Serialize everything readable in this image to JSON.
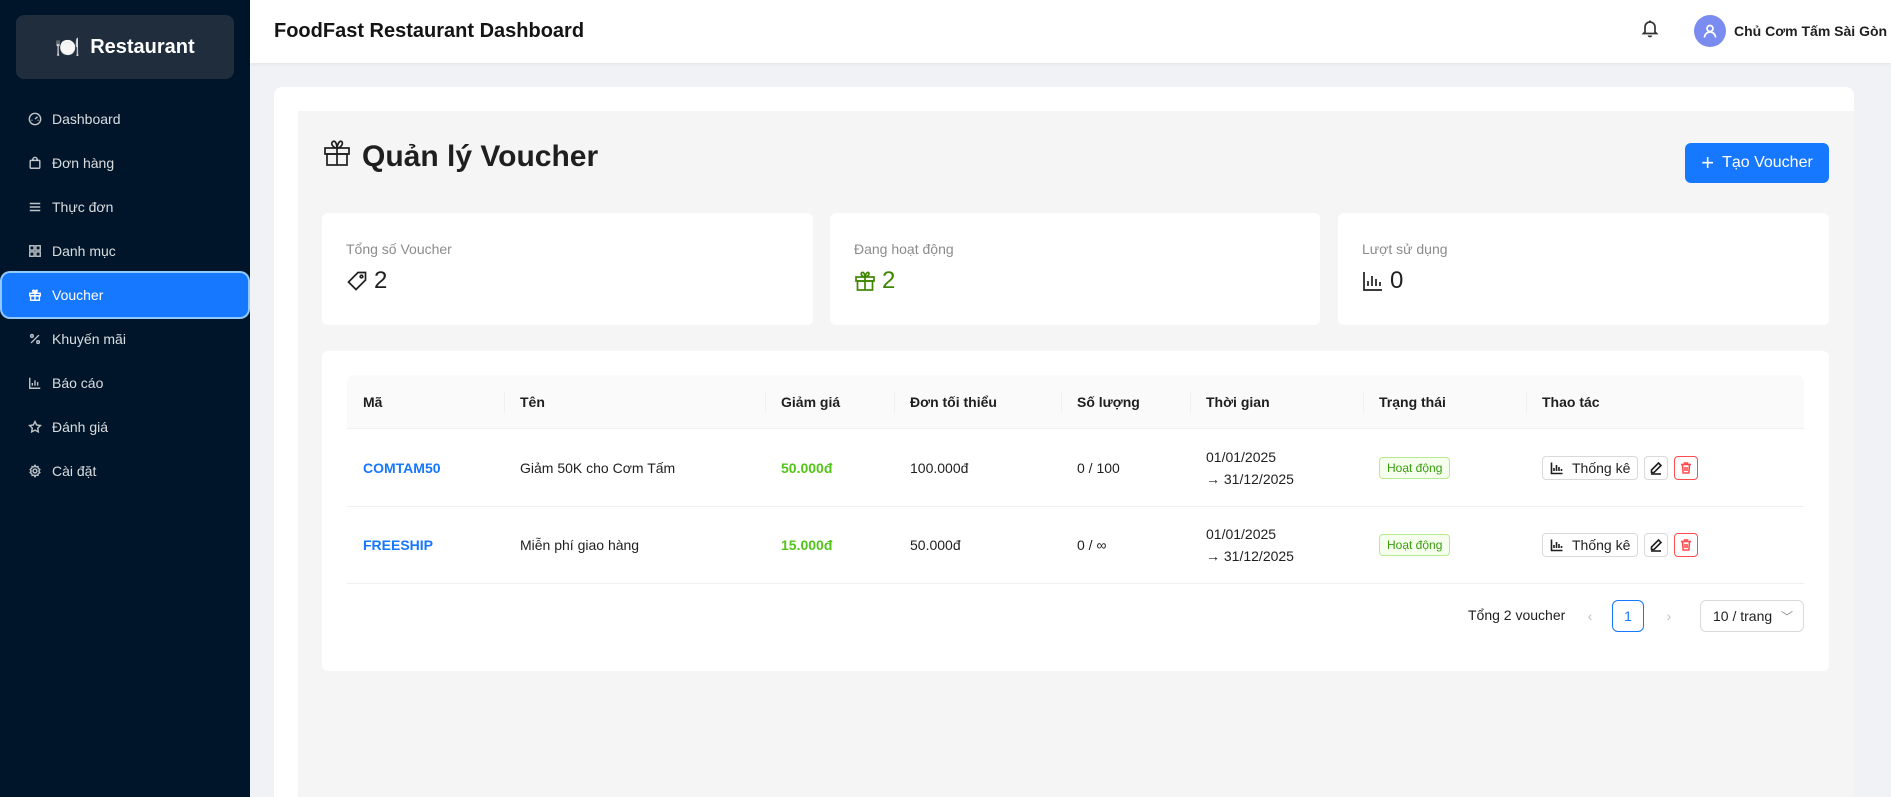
{
  "sidebar": {
    "logo_icon": "🍽️",
    "logo_text": "Restaurant",
    "items": [
      {
        "label": "Dashboard",
        "icon": "dashboard-icon"
      },
      {
        "label": "Đơn hàng",
        "icon": "shopping-bag-icon"
      },
      {
        "label": "Thực đơn",
        "icon": "menu-list-icon"
      },
      {
        "label": "Danh mục",
        "icon": "category-grid-icon"
      },
      {
        "label": "Voucher",
        "icon": "gift-icon",
        "active": true
      },
      {
        "label": "Khuyến mãi",
        "icon": "percent-icon"
      },
      {
        "label": "Báo cáo",
        "icon": "bar-chart-icon"
      },
      {
        "label": "Đánh giá",
        "icon": "star-icon"
      },
      {
        "label": "Cài đặt",
        "icon": "gear-icon"
      }
    ]
  },
  "header": {
    "title": "FoodFast Restaurant Dashboard",
    "user_name": "Chủ Cơm Tấm Sài Gòn"
  },
  "page": {
    "title": "Quản lý Voucher",
    "create_button": "Tạo Voucher"
  },
  "stats": [
    {
      "label": "Tổng số Voucher",
      "value": "2",
      "icon": "tag-icon"
    },
    {
      "label": "Đang hoạt động",
      "value": "2",
      "icon": "gift-icon"
    },
    {
      "label": "Lượt sử dụng",
      "value": "0",
      "icon": "bar-chart-icon"
    }
  ],
  "table": {
    "columns": [
      "Mã",
      "Tên",
      "Giảm giá",
      "Đơn tối thiểu",
      "Số lượng",
      "Thời gian",
      "Trạng thái",
      "Thao tác"
    ],
    "rows": [
      {
        "code": "COMTAM50",
        "name": "Giảm 50K cho Cơm Tấm",
        "discount": "50.000đ",
        "min_order": "100.000đ",
        "quantity": "0 / 100",
        "time_start": "01/01/2025",
        "time_end": "→ 31/12/2025",
        "status": "Hoạt động",
        "stat_label": "Thống kê"
      },
      {
        "code": "FREESHIP",
        "name": "Miễn phí giao hàng",
        "discount": "15.000đ",
        "min_order": "50.000đ",
        "quantity": "0 / ∞",
        "time_start": "01/01/2025",
        "time_end": "→ 31/12/2025",
        "status": "Hoạt động",
        "stat_label": "Thống kê"
      }
    ]
  },
  "pagination": {
    "total": "Tổng 2 voucher",
    "current_page": "1",
    "page_size": "10 / trang",
    "prev": "‹",
    "next": "›"
  },
  "colors": {
    "primary": "#1677ff",
    "sidebar_bg": "#001529",
    "success": "#52c41a",
    "danger": "#ff4d4f"
  }
}
